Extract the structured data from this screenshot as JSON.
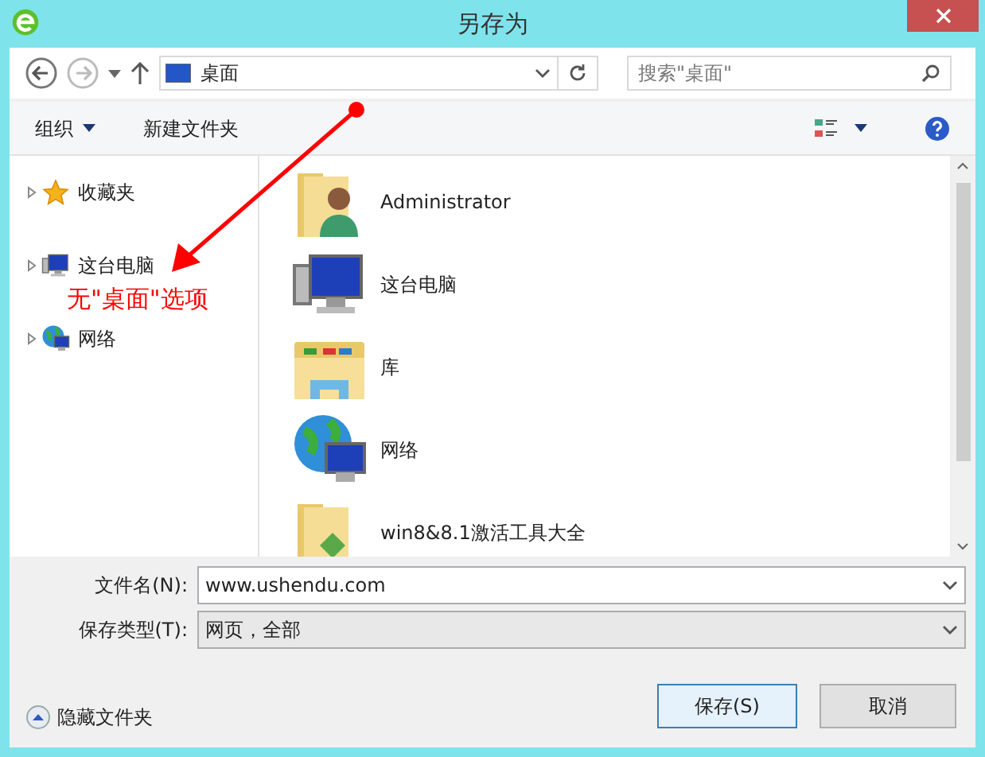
{
  "window": {
    "title": "另存为"
  },
  "address_bar": {
    "location": "桌面"
  },
  "search": {
    "placeholder": "搜索\"桌面\""
  },
  "toolbar": {
    "organize": "组织",
    "new_folder": "新建文件夹"
  },
  "sidebar": {
    "items": [
      {
        "label": "收藏夹",
        "kind": "star",
        "expanded": false
      },
      {
        "label": "这台电脑",
        "kind": "computer",
        "expanded": false
      },
      {
        "label": "网络",
        "kind": "network",
        "expanded": false
      }
    ]
  },
  "annotation": {
    "text": "无\"桌面\"选项"
  },
  "files": [
    {
      "name": "Administrator",
      "kind": "user"
    },
    {
      "name": "这台电脑",
      "kind": "computer"
    },
    {
      "name": "库",
      "kind": "library"
    },
    {
      "name": "网络",
      "kind": "network"
    },
    {
      "name": "win8&8.1激活工具大全",
      "kind": "folder"
    }
  ],
  "form": {
    "filename_label": "文件名(N):",
    "filename": "www.ushendu.com",
    "type_label": "保存类型(T):",
    "type": "网页，全部"
  },
  "footer": {
    "hide_folders": "隐藏文件夹",
    "save": "保存(S)",
    "cancel": "取消"
  }
}
